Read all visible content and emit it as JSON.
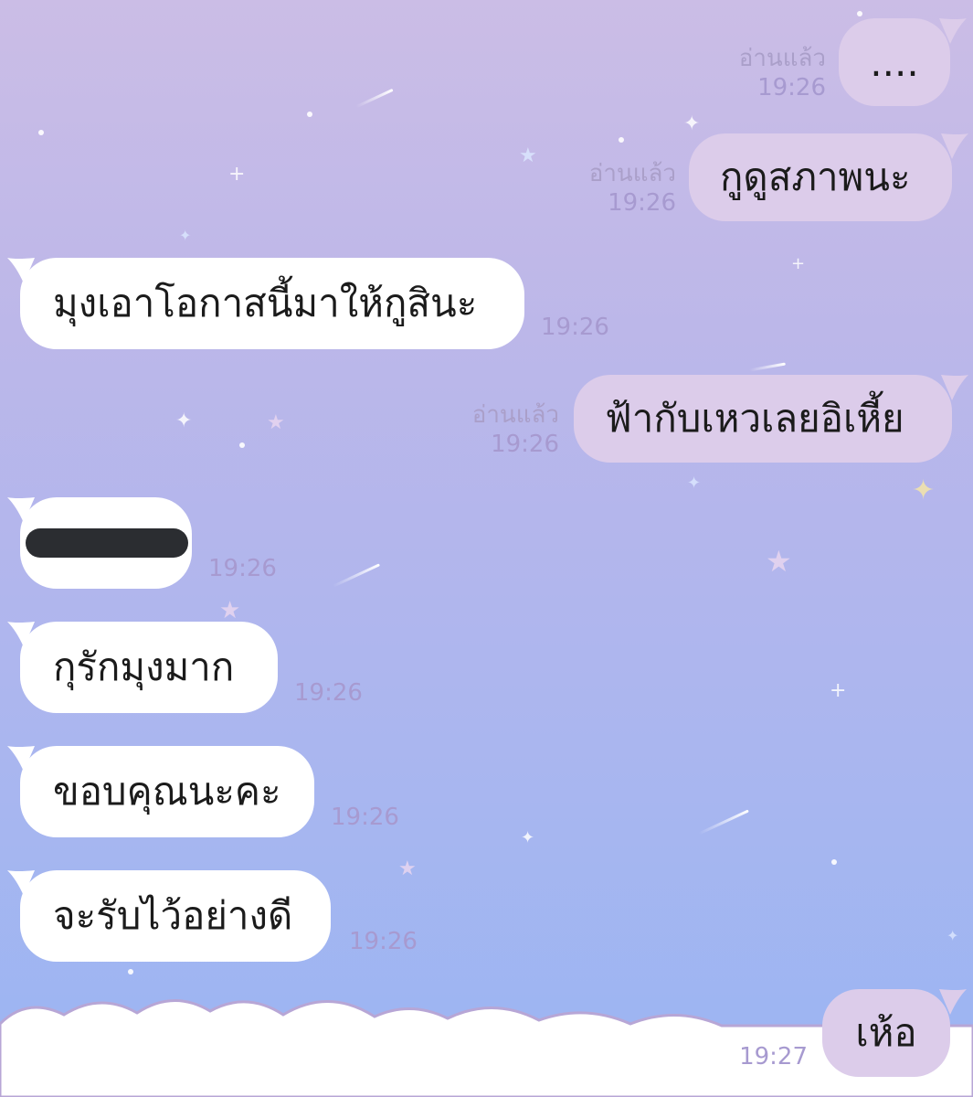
{
  "theme": {
    "bg_top": "#cbbde6",
    "bg_bottom": "#9ab5f3",
    "bubble_in": "#ffffff",
    "bubble_out": "#dcccea",
    "meta_color": "#a79ad0"
  },
  "messages": [
    {
      "side": "out",
      "text": "....",
      "read": "อ่านแล้ว",
      "time": "19:26"
    },
    {
      "side": "out",
      "text": "กูดูสภาพนะ",
      "read": "อ่านแล้ว",
      "time": "19:26"
    },
    {
      "side": "in",
      "text": "มุงเอาโอกาสนี้มาให้กูสินะ",
      "time": "19:26"
    },
    {
      "side": "out",
      "text": "ฟ้ากับเหวเลยอิเหี้ย",
      "read": "อ่านแล้ว",
      "time": "19:26"
    },
    {
      "side": "in",
      "text": "",
      "redacted": true,
      "time": "19:26"
    },
    {
      "side": "in",
      "text": "กุรักมุงมาก",
      "time": "19:26"
    },
    {
      "side": "in",
      "text": "ขอบคุณนะคะ",
      "time": "19:26"
    },
    {
      "side": "in",
      "text": "จะรับไว้อย่างดี",
      "time": "19:26"
    },
    {
      "side": "out",
      "text": "เห้อ",
      "time": "19:27"
    }
  ]
}
